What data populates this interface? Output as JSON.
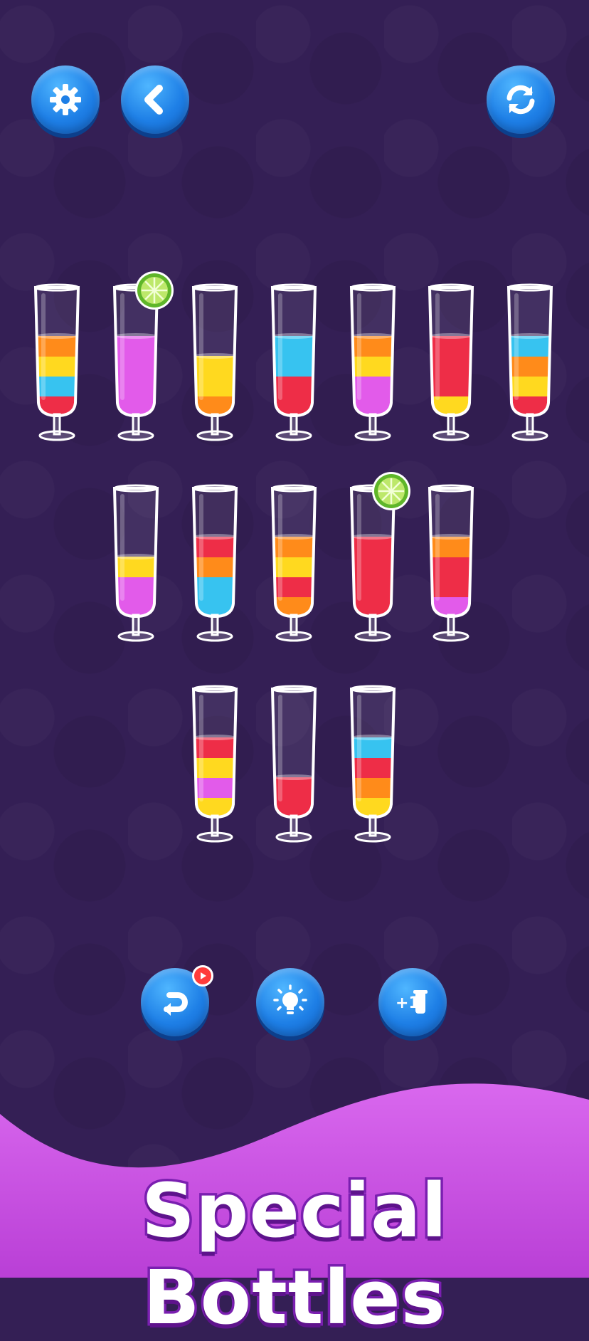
{
  "toolbar": {
    "settings": {
      "icon": "gear-icon"
    },
    "back": {
      "icon": "chevron-left-icon"
    },
    "restart": {
      "icon": "refresh-icon"
    }
  },
  "powerups": {
    "undo": {
      "icon": "undo-arrow-icon",
      "badge_icon": "play-video-icon"
    },
    "hint": {
      "icon": "lightbulb-icon"
    },
    "add_tube": {
      "icon": "plus-tube-icon",
      "label": "+1"
    }
  },
  "colors": {
    "red": "#ee2d47",
    "orange": "#ff8b1a",
    "yellow": "#ffd91f",
    "blue": "#37c3f0",
    "pink": "#e25bea",
    "background": "#341f55",
    "button": "#1e7fe6",
    "banner": "#d35ae8"
  },
  "glasses": [
    {
      "row": 1,
      "layers": [
        "red",
        "blue",
        "yellow",
        "orange"
      ],
      "lime": false
    },
    {
      "row": 1,
      "layers": [
        "pink",
        "pink",
        "pink",
        "pink"
      ],
      "lime": true
    },
    {
      "row": 1,
      "layers": [
        "orange",
        "yellow",
        "yellow"
      ],
      "lime": false
    },
    {
      "row": 1,
      "layers": [
        "red",
        "red",
        "blue",
        "blue"
      ],
      "lime": false
    },
    {
      "row": 1,
      "layers": [
        "pink",
        "pink",
        "yellow",
        "orange"
      ],
      "lime": false
    },
    {
      "row": 1,
      "layers": [
        "yellow",
        "red",
        "red",
        "red"
      ],
      "lime": false
    },
    {
      "row": 1,
      "layers": [
        "red",
        "yellow",
        "orange",
        "blue"
      ],
      "lime": false
    },
    {
      "row": 2,
      "layers": [
        "pink",
        "pink",
        "yellow"
      ],
      "lime": false
    },
    {
      "row": 2,
      "layers": [
        "blue",
        "blue",
        "orange",
        "red"
      ],
      "lime": false
    },
    {
      "row": 2,
      "layers": [
        "orange",
        "red",
        "yellow",
        "orange"
      ],
      "lime": false
    },
    {
      "row": 2,
      "layers": [
        "red",
        "red",
        "red",
        "red"
      ],
      "lime": true
    },
    {
      "row": 2,
      "layers": [
        "pink",
        "red",
        "red",
        "orange"
      ],
      "lime": false
    },
    {
      "row": 3,
      "layers": [
        "yellow",
        "pink",
        "yellow",
        "red"
      ],
      "lime": false
    },
    {
      "row": 3,
      "layers": [
        "red",
        "red"
      ],
      "lime": false
    },
    {
      "row": 3,
      "layers": [
        "yellow",
        "orange",
        "red",
        "blue"
      ],
      "lime": false
    }
  ],
  "banner": {
    "title": "Special Bottles"
  }
}
